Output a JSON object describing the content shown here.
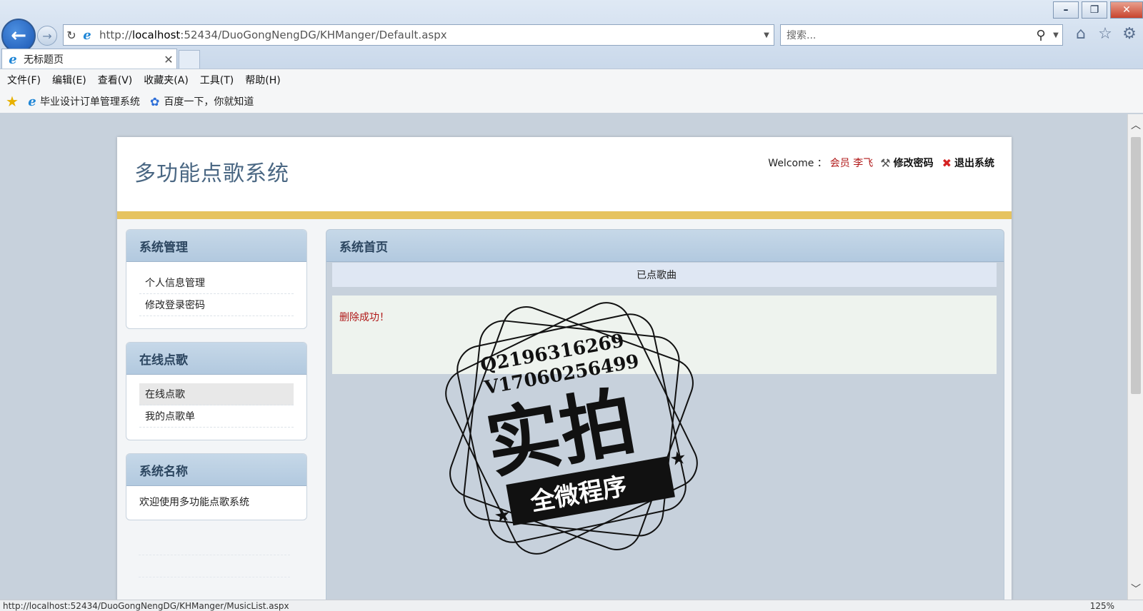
{
  "browser": {
    "back_icon": "back-arrow-icon",
    "forward_icon": "forward-arrow-icon",
    "url_host": "localhost",
    "url_prefix": "http://",
    "url_rest": ":52434/DuoGongNengDG/KHManger/Default.aspx",
    "search_placeholder": "搜索...",
    "tab_title": "无标题页",
    "menu": [
      "文件(F)",
      "编辑(E)",
      "查看(V)",
      "收藏夹(A)",
      "工具(T)",
      "帮助(H)"
    ],
    "favorites": [
      "毕业设计订单管理系统",
      "百度一下，你就知道"
    ],
    "status_url": "http://localhost:52434/DuoGongNengDG/KHManger/MusicList.aspx",
    "zoom": "125%"
  },
  "header": {
    "site_title": "多功能点歌系统",
    "welcome": "Welcome ：",
    "user": "会员 李飞",
    "change_password": "修改密码",
    "logout": "退出系统"
  },
  "sidebar": {
    "system_manage": {
      "title": "系统管理",
      "items": [
        "个人信息管理",
        "修改登录密码"
      ]
    },
    "online_song": {
      "title": "在线点歌",
      "items": [
        "在线点歌",
        "我的点歌单"
      ]
    },
    "system_name": {
      "title": "系统名称",
      "text": "欢迎使用多功能点歌系统"
    }
  },
  "main": {
    "title": "系统首页",
    "breadcrumb": "已点歌曲",
    "message": "删除成功！"
  },
  "watermark": {
    "line1": "Q2196316269",
    "line2": "V17060256499",
    "big": "实拍",
    "ribbon": "全微程序"
  },
  "colors": {
    "accent_gold": "#e6c35f",
    "panel_header": "#b2c9df",
    "error_red": "#b01818"
  }
}
